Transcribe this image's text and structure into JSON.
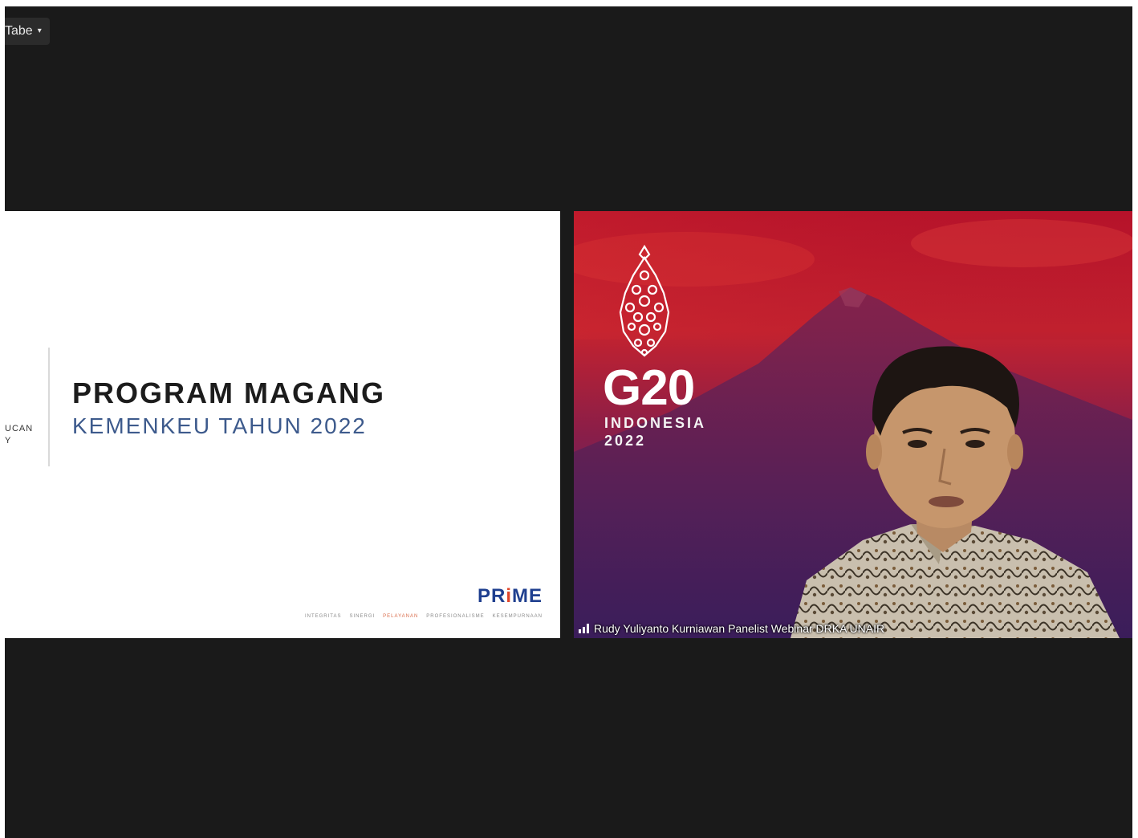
{
  "toolbar": {
    "view_label": "Tabe",
    "view_caret": "▾"
  },
  "shared_screen": {
    "logo_fragment_line1": "UCAN",
    "logo_fragment_line2": "Y",
    "title": "PROGRAM MAGANG",
    "subtitle": "KEMENKEU TAHUN 2022",
    "prime_logo": {
      "part1": "PR",
      "part2": "i",
      "part3": "ME"
    },
    "values": [
      "INTEGRITAS",
      "SINERGI",
      "PELAYANAN",
      "PROFESIONALISME",
      "KESEMPURNAAN"
    ]
  },
  "participant": {
    "background": {
      "emblem_text": "G20",
      "country": "INDONESIA",
      "year": "2022"
    },
    "name": "Rudy Yuliyanto Kurniawan Panelist Webinar DRKA UNAIR",
    "colors": {
      "bg_top": "#b8122a",
      "bg_bottom": "#3d1f5c"
    }
  }
}
